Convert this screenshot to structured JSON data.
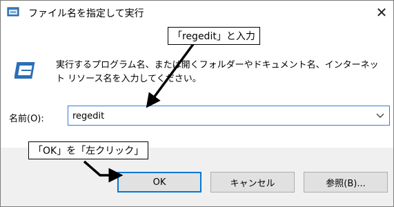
{
  "dialog": {
    "title": "ファイル名を指定して実行",
    "close_glyph": "✕",
    "description": "実行するプログラム名、または開くフォルダーやドキュメント名、インターネット リソース名を入力してください。",
    "name_label": "名前(O):",
    "name_value": "regedit"
  },
  "buttons": {
    "ok": "OK",
    "cancel": "キャンセル",
    "browse": "参照(B)..."
  },
  "annotations": {
    "callout_input": "「regedit」と入力",
    "callout_ok": "「OK」を「左クリック」"
  },
  "icons": {
    "title": "run-window-icon",
    "main": "run-dialog-icon",
    "dropdown": "chevron-down-icon"
  },
  "colors": {
    "accent": "#0078d7",
    "footer_bg": "#f0f0f0",
    "button_bg": "#e1e1e1"
  }
}
